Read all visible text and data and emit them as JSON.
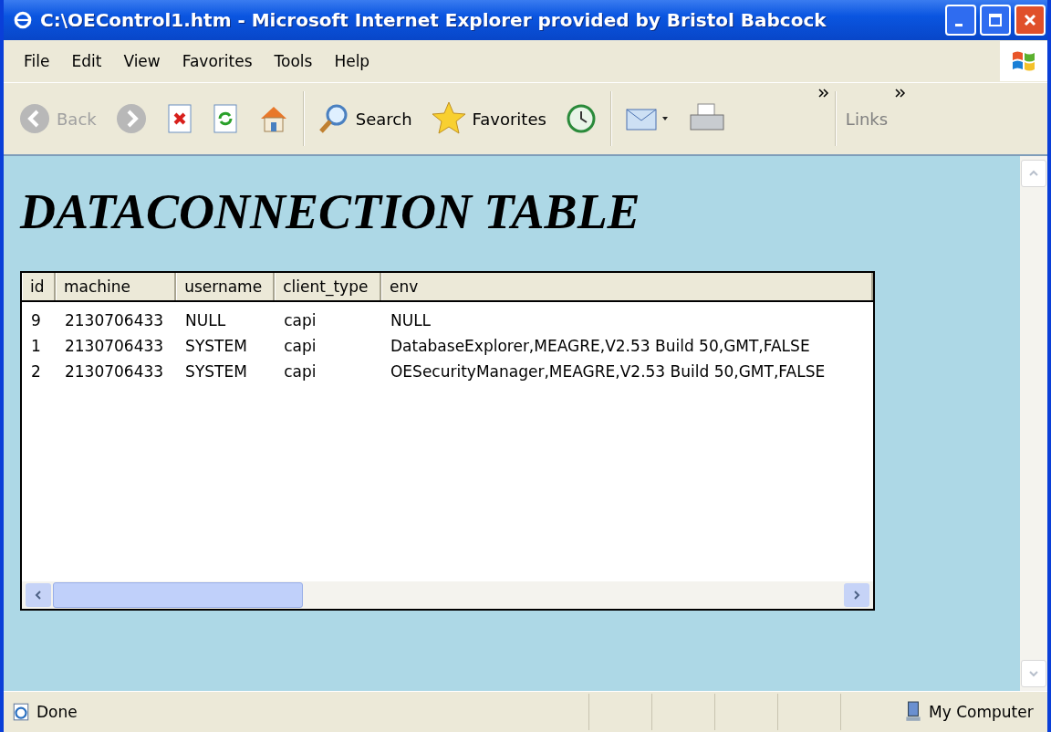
{
  "window": {
    "title": "C:\\OEControl1.htm - Microsoft Internet Explorer provided by Bristol Babcock"
  },
  "menu": [
    "File",
    "Edit",
    "View",
    "Favorites",
    "Tools",
    "Help"
  ],
  "toolbar": [
    {
      "kind": "back",
      "label": "Back",
      "disabled": true
    },
    {
      "kind": "forward",
      "disabled": true
    },
    {
      "kind": "stop"
    },
    {
      "kind": "refresh"
    },
    {
      "kind": "home"
    },
    {
      "kind": "search",
      "label": "Search"
    },
    {
      "kind": "favorites",
      "label": "Favorites"
    },
    {
      "kind": "history"
    },
    {
      "kind": "mail"
    },
    {
      "kind": "print"
    }
  ],
  "links": {
    "label": "Links"
  },
  "page": {
    "heading": "DATACONNECTION TABLE",
    "table": {
      "columns": [
        "id",
        "machine",
        "username",
        "client_type",
        "env"
      ],
      "rows": [
        [
          "9",
          "2130706433",
          "NULL",
          "capi",
          "NULL"
        ],
        [
          "1",
          "2130706433",
          "SYSTEM",
          "capi",
          "DatabaseExplorer,MEAGRE,V2.53 Build 50,GMT,FALSE"
        ],
        [
          "2",
          "2130706433",
          "SYSTEM",
          "capi",
          "OESecurityManager,MEAGRE,V2.53 Build 50,GMT,FALSE"
        ]
      ]
    }
  },
  "status_bar": {
    "text": "Done",
    "zone": "My Computer"
  }
}
